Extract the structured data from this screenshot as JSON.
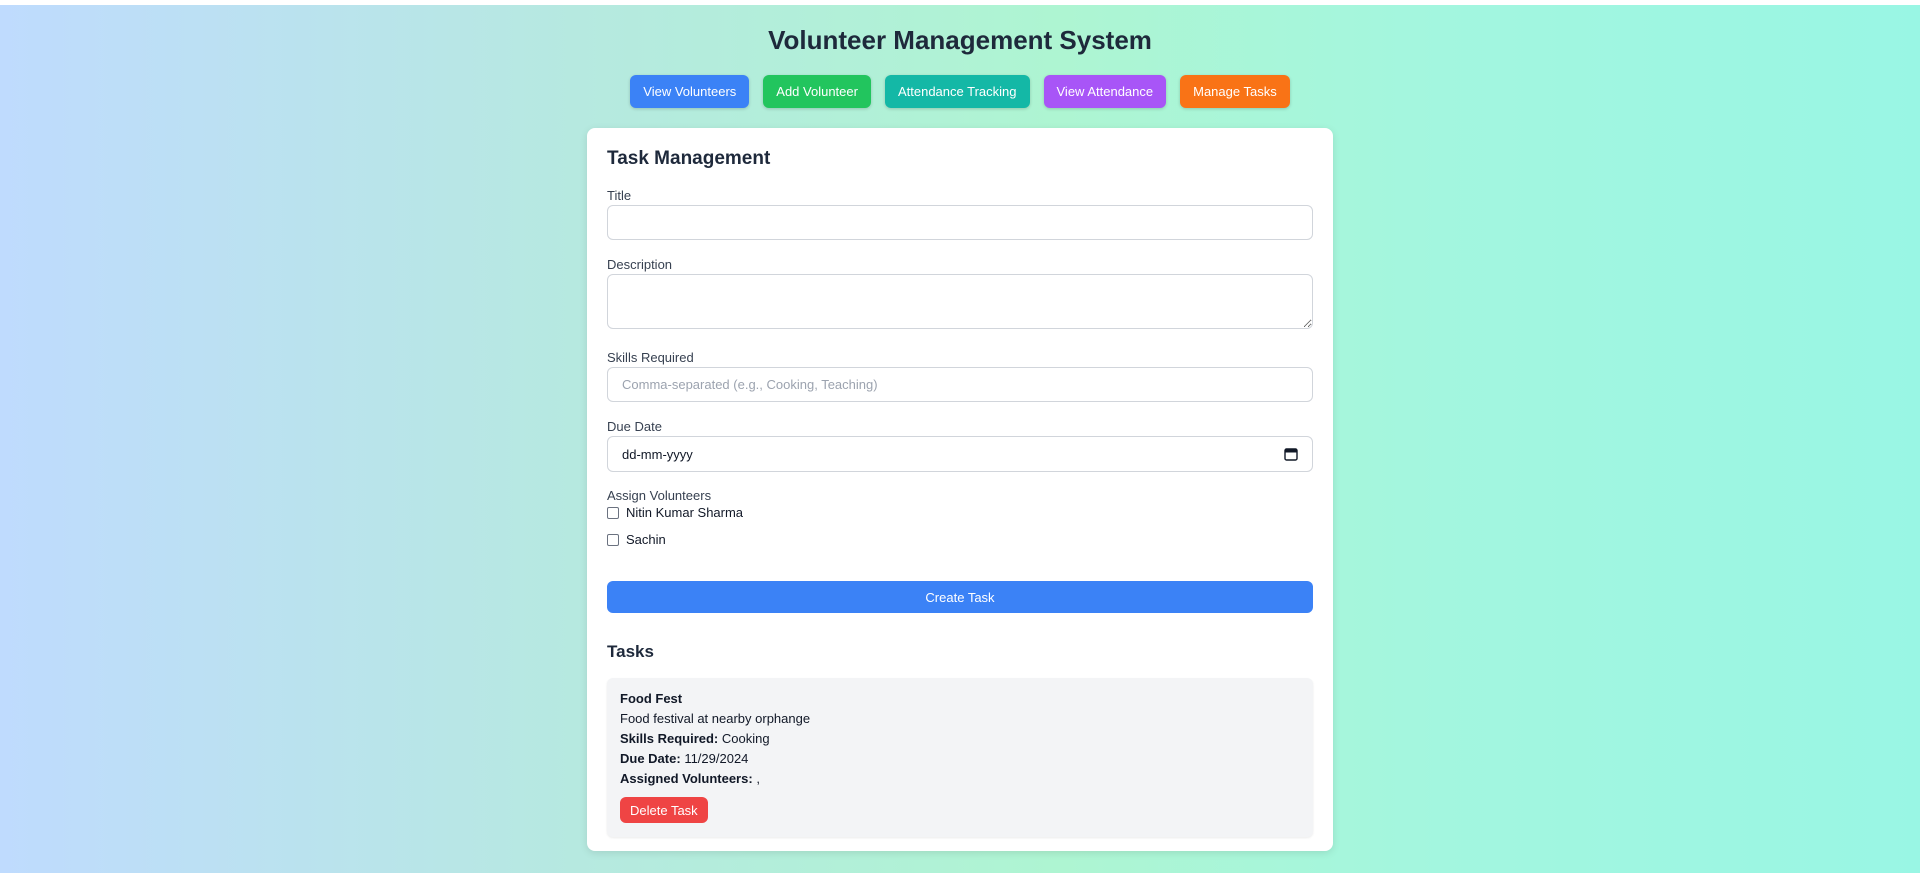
{
  "app": {
    "title": "Volunteer Management System"
  },
  "nav": {
    "items": [
      {
        "label": "View Volunteers",
        "color": "#3b82f6"
      },
      {
        "label": "Add Volunteer",
        "color": "#22c55e"
      },
      {
        "label": "Attendance Tracking",
        "color": "#14b8a6"
      },
      {
        "label": "View Attendance",
        "color": "#a855f7"
      },
      {
        "label": "Manage Tasks",
        "color": "#f97316"
      }
    ]
  },
  "form": {
    "heading": "Task Management",
    "title_label": "Title",
    "title_value": "",
    "description_label": "Description",
    "description_value": "",
    "skills_label": "Skills Required",
    "skills_placeholder": "Comma-separated (e.g., Cooking, Teaching)",
    "due_date_label": "Due Date",
    "due_date_placeholder": "dd-mm-yyyy",
    "assign_label": "Assign Volunteers",
    "volunteers": [
      {
        "name": "Nitin Kumar Sharma",
        "checked": false
      },
      {
        "name": "Sachin",
        "checked": false
      }
    ],
    "submit_label": "Create Task",
    "submit_color": "#3b82f6"
  },
  "tasks": {
    "heading": "Tasks",
    "items": [
      {
        "title": "Food Fest",
        "description": "Food festival at nearby orphange",
        "skills_label": "Skills Required:",
        "skills_value": "Cooking",
        "due_label": "Due Date:",
        "due_value": "11/29/2024",
        "assigned_label": "Assigned Volunteers:",
        "assigned_value": ",",
        "delete_label": "Delete Task",
        "delete_color": "#ef4444"
      }
    ]
  }
}
